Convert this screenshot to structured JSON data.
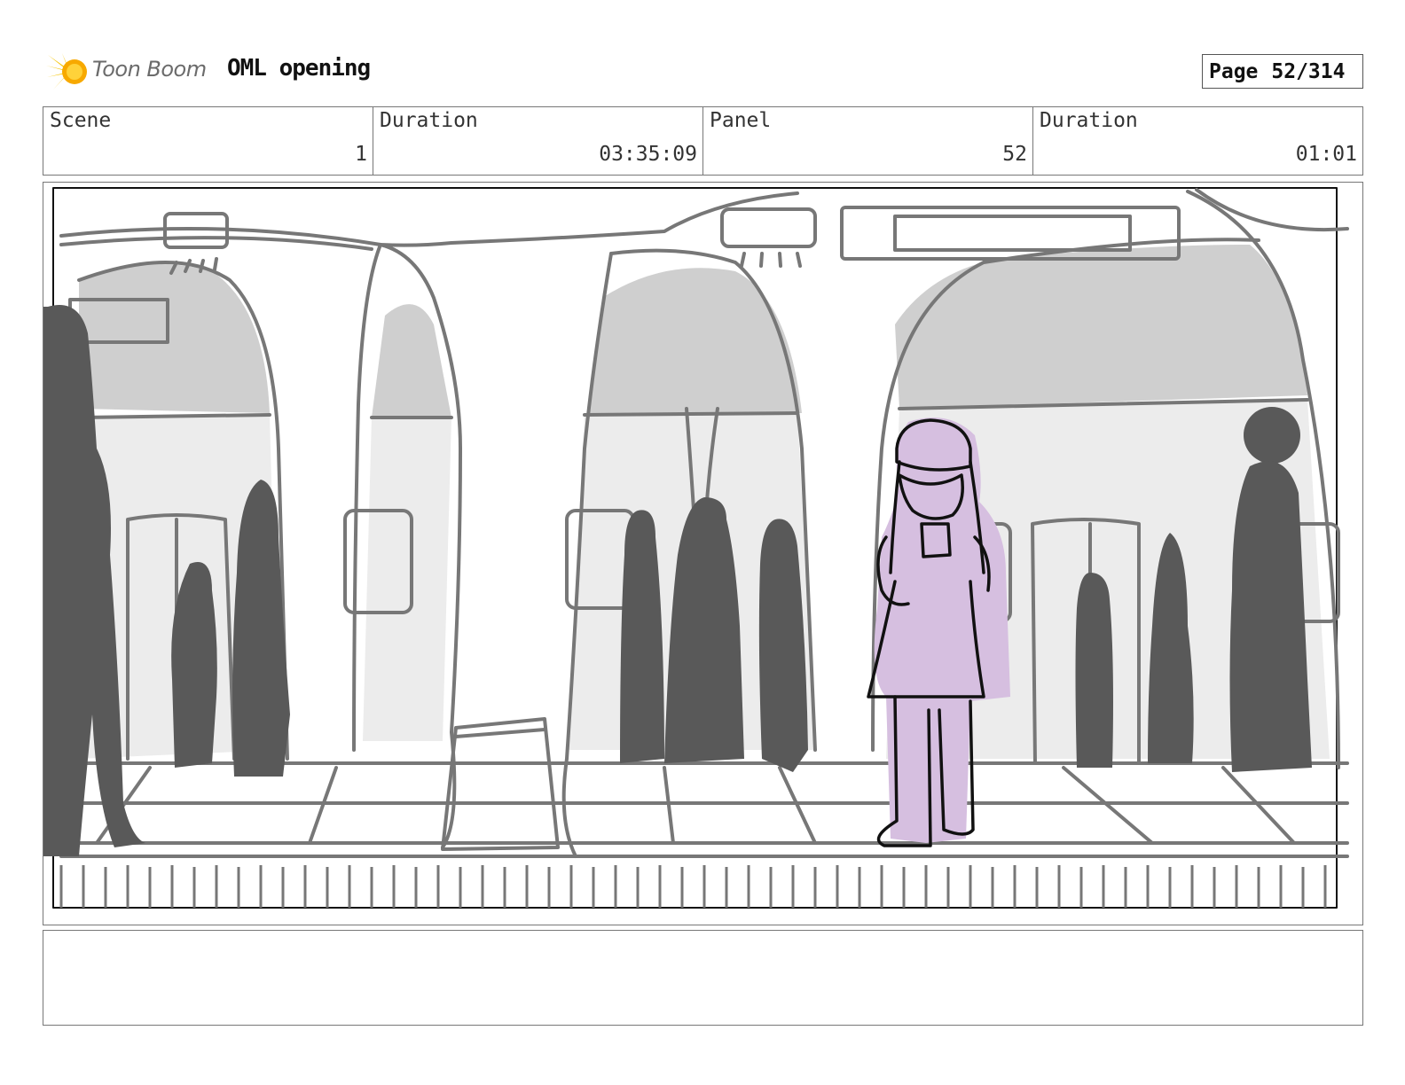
{
  "header": {
    "logo_text": "Toon Boom",
    "project_title": "OML opening",
    "page_label": "Page",
    "page_number": "52/314"
  },
  "info": {
    "scene_label": "Scene",
    "scene_value": "1",
    "duration_label": "Duration",
    "duration_value": "03:35:09",
    "panel_label": "Panel",
    "panel_value": "52",
    "panel_duration_label": "Duration",
    "panel_duration_value": "01:01"
  },
  "panel": {
    "colors": {
      "sketch_line": "#777777",
      "silhouette": "#595959",
      "shade": "#cfcfcf",
      "light_shade": "#ececec",
      "character_fill": "#d6bfe0",
      "character_line": "#111111"
    }
  },
  "notes": {
    "text": ""
  }
}
